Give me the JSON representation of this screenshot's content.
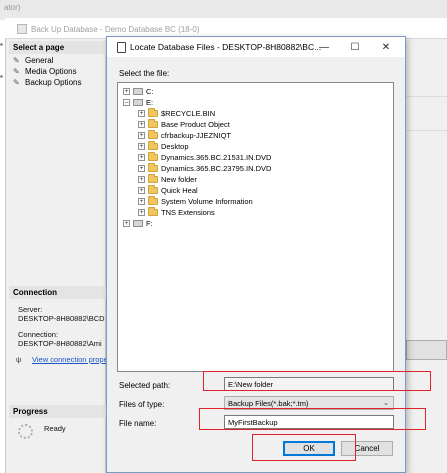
{
  "top_strip": {
    "text": "ator)"
  },
  "backup_dialog": {
    "title": "Back Up Database - Demo Database BC (18-0)",
    "select_page": "Select a page",
    "pages": [
      "General",
      "Media Options",
      "Backup Options"
    ],
    "connection_header": "Connection",
    "server_label": "Server:",
    "server_value": "DESKTOP-8H80882\\BCD",
    "connection_label": "Connection:",
    "connection_value": "DESKTOP-8H80882\\Ami",
    "view_connection_link": "View connection prope",
    "progress_header": "Progress",
    "progress_status": "Ready"
  },
  "locate_dialog": {
    "title": "Locate Database Files - DESKTOP-8H80882\\BC...",
    "minimize_glyph": "—",
    "maximize_glyph": "☐",
    "close_glyph": "✕",
    "select_file_label": "Select the file:",
    "tree": [
      {
        "label": "C:",
        "type": "drive",
        "level": 0,
        "expander": "+"
      },
      {
        "label": "E:",
        "type": "drive",
        "level": 0,
        "expander": "−"
      },
      {
        "label": "$RECYCLE.BIN",
        "type": "folder",
        "level": 1,
        "expander": "+"
      },
      {
        "label": "Base Product Object",
        "type": "folder",
        "level": 1,
        "expander": "+"
      },
      {
        "label": "cfrbackup-JJEZNIQT",
        "type": "folder",
        "level": 1,
        "expander": "+"
      },
      {
        "label": "Desktop",
        "type": "folder",
        "level": 1,
        "expander": "+"
      },
      {
        "label": "Dynamics.365.BC.21531.IN.DVD",
        "type": "folder",
        "level": 1,
        "expander": "+"
      },
      {
        "label": "Dynamics.365.BC.23795.IN.DVD",
        "type": "folder",
        "level": 1,
        "expander": "+"
      },
      {
        "label": "New folder",
        "type": "folder",
        "level": 1,
        "expander": "+"
      },
      {
        "label": "Quick Heal",
        "type": "folder",
        "level": 1,
        "expander": "+"
      },
      {
        "label": "System Volume Information",
        "type": "folder",
        "level": 1,
        "expander": "+"
      },
      {
        "label": "TNS Extensions",
        "type": "folder",
        "level": 1,
        "expander": "+"
      },
      {
        "label": "F:",
        "type": "drive",
        "level": 0,
        "expander": "+"
      }
    ],
    "selected_path_label": "Selected path:",
    "selected_path_value": "E:\\New folder",
    "files_of_type_label": "Files of type:",
    "files_of_type_value": "Backup Files(*.bak;*.tm)",
    "file_name_label": "File name:",
    "file_name_value": "MyFirstBackup",
    "ok_label": "OK",
    "cancel_label": "Cancel"
  },
  "highlight_color": "#e0222b"
}
